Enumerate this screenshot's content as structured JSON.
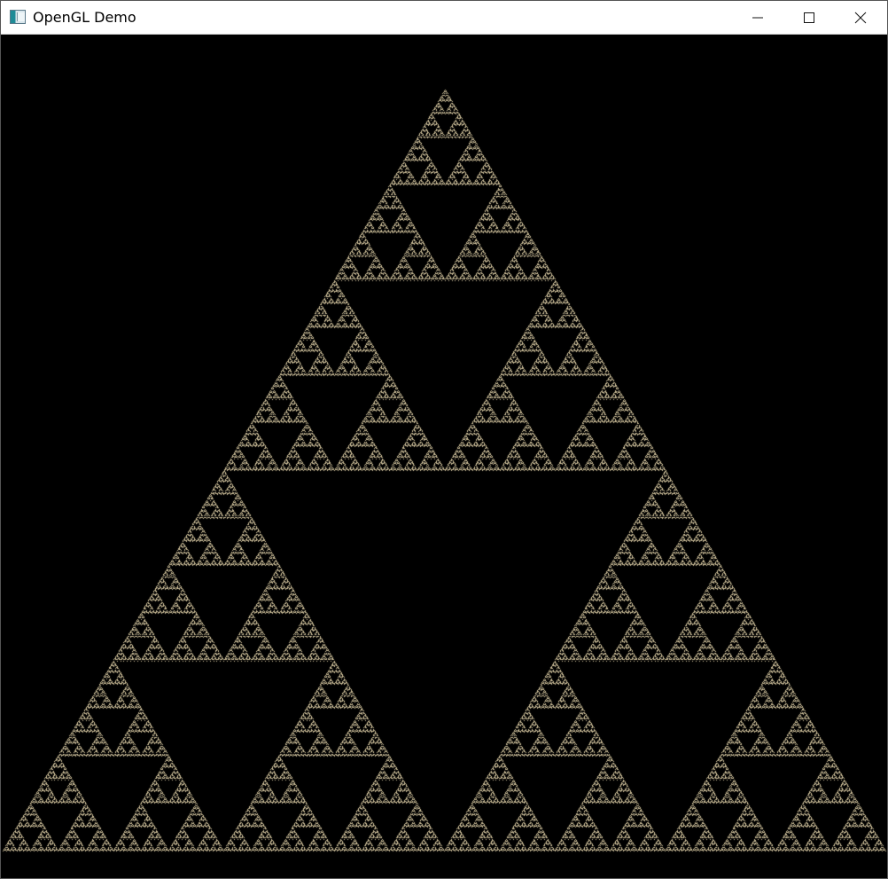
{
  "window": {
    "title": "OpenGL Demo",
    "icon": "opengl-window-icon",
    "controls": {
      "minimize_icon": "minimize-icon",
      "maximize_icon": "maximize-icon",
      "close_icon": "close-icon"
    }
  },
  "scene": {
    "background_color": "#000000",
    "point_color": "#d8c9a1",
    "shape": "sierpinski-triangle"
  }
}
